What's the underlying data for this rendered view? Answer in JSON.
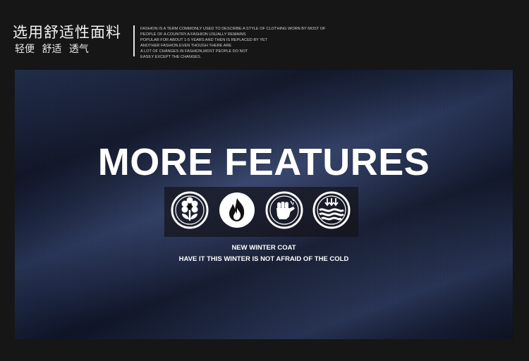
{
  "header": {
    "title": "选用舒适性面料",
    "subtitle": "轻便 舒适 透气",
    "blurb_lines": [
      "FASHION IS A TERM COMMONLY USED TO DESCRIBE A STYLE OF CLOTHING WORN BY MOST OF",
      "PEOPLE OF A COUNTRY.A FASHION USUALLY REMAINS",
      "POPULAR FOR ABOUT 1-5 YEARS AND THEN IS REPLACED BY YET",
      "ANOTHER FASHION.EVEN  THOUGH THERE ARE",
      " A LOT OF CHANGES IN FASHION,MOST PEOPLE DO NOT",
      "EASILY EXCEPT THE CHANGES."
    ]
  },
  "hero": {
    "title": "MORE FEATURES",
    "caption_line1": "NEW WINTER COAT",
    "caption_line2": "HAVE IT THIS WINTER IS NOT AFRAID OF THE COLD",
    "fabric_color": "#1c2748"
  },
  "icons": [
    "flower-icon",
    "flame-icon",
    "fist-icon",
    "water-waves-icon"
  ]
}
